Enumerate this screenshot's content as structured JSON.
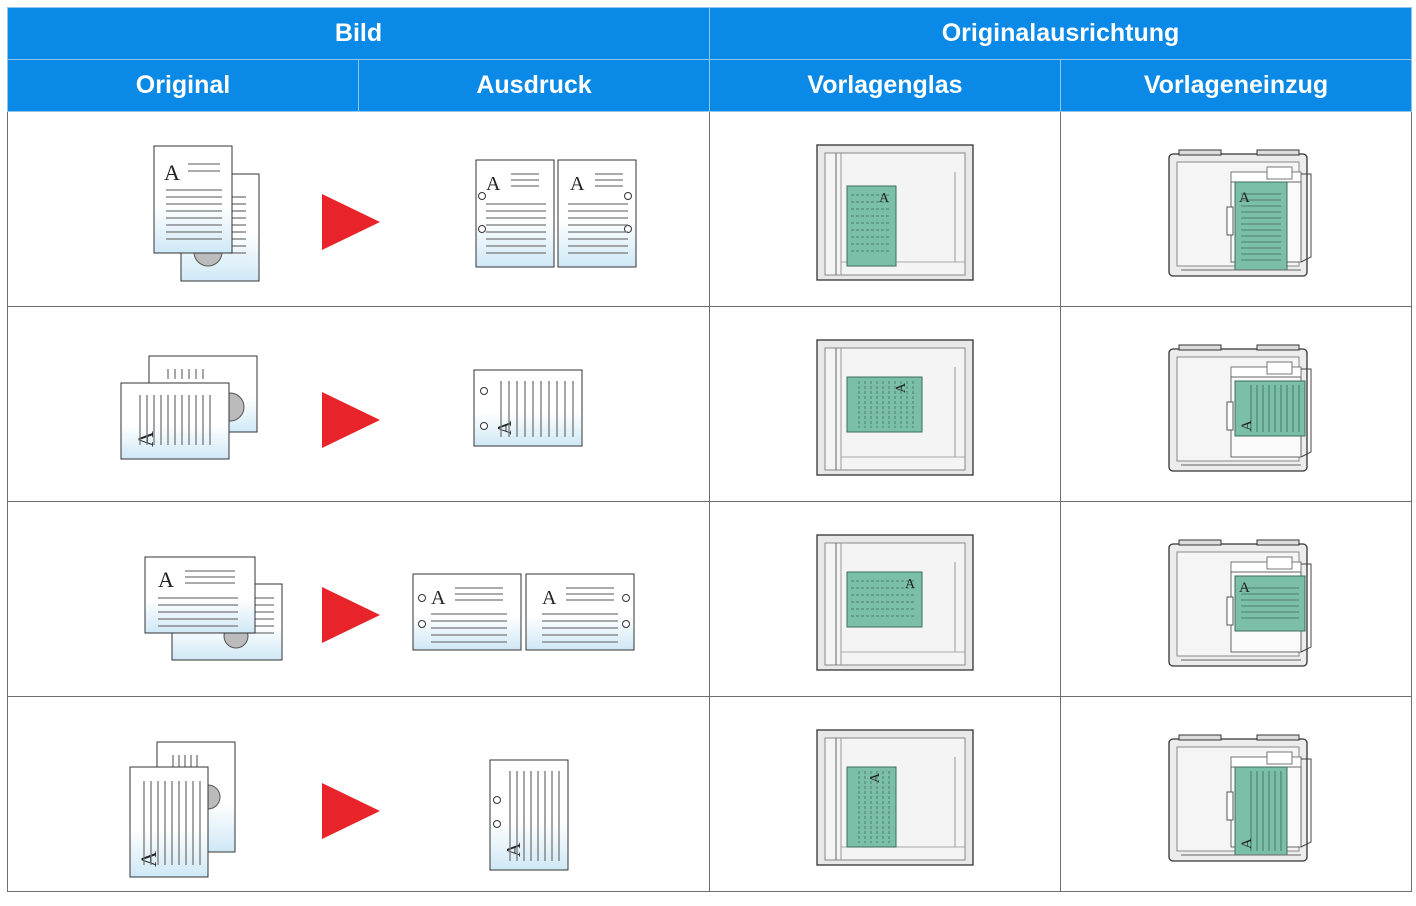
{
  "header": {
    "bild": "Bild",
    "originalausrichtung": "Originalausrichtung",
    "original": "Original",
    "ausdruck": "Ausdruck",
    "vorlagenglas": "Vorlagenglas",
    "vorlageneinzug": "Vorlageneinzug"
  },
  "glyph": "A",
  "colors": {
    "header_bg": "#0a8ae6",
    "arrow": "#e8232a",
    "doc_green": "#7cbfa9",
    "paper_gradient_bottom": "#cfe8f6"
  },
  "icons": [
    "document-stack-icon",
    "arrow-right-icon",
    "printout-icon",
    "platen-glass-icon",
    "document-feeder-icon"
  ],
  "rows": [
    {
      "name": "row-portrait-upright"
    },
    {
      "name": "row-portrait-sideways"
    },
    {
      "name": "row-landscape-upright"
    },
    {
      "name": "row-landscape-sideways"
    }
  ]
}
